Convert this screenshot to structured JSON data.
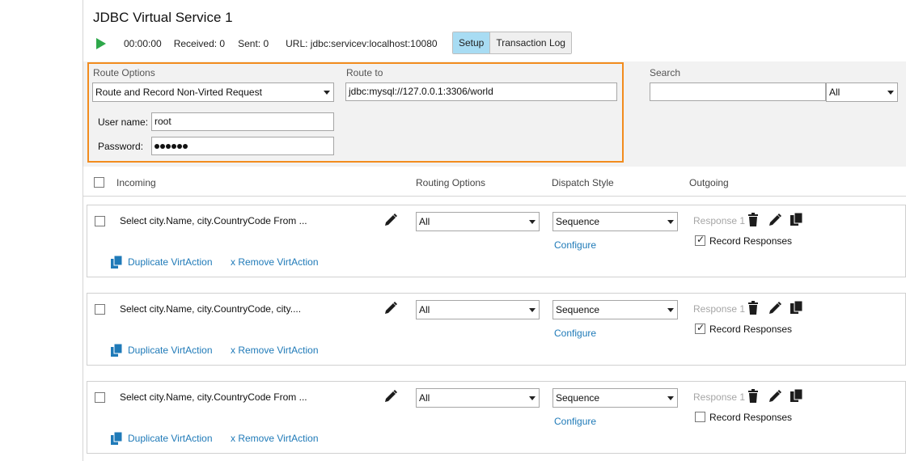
{
  "title": "JDBC Virtual Service 1",
  "toolbar": {
    "time": "00:00:00",
    "received": "Received: 0",
    "sent": "Sent: 0",
    "url": "URL: jdbc:servicev:localhost:10080"
  },
  "tabs": {
    "setup": "Setup",
    "log": "Transaction Log"
  },
  "route": {
    "options_label": "Route Options",
    "options_value": "Route and Record Non-Virted Request",
    "to_label": "Route to",
    "to_value": "jdbc:mysql://127.0.0.1:3306/world",
    "user_label": "User name:",
    "user_value": "root",
    "password_label": "Password:"
  },
  "search": {
    "label": "Search",
    "value": "",
    "filter": "All"
  },
  "columns": {
    "incoming": "Incoming",
    "routing": "Routing Options",
    "dispatch": "Dispatch Style",
    "outgoing": "Outgoing"
  },
  "rows": [
    {
      "query": "Select city.Name, city.CountryCode From ...",
      "routing": "All",
      "dispatch": "Sequence",
      "configure": "Configure",
      "response": "Response 1",
      "record": "Record Responses",
      "recorded": true,
      "duplicate": "Duplicate VirtAction",
      "remove": "x Remove VirtAction"
    },
    {
      "query": "Select city.Name, city.CountryCode, city....",
      "routing": "All",
      "dispatch": "Sequence",
      "configure": "Configure",
      "response": "Response 1",
      "record": "Record Responses",
      "recorded": true,
      "duplicate": "Duplicate VirtAction",
      "remove": "x Remove VirtAction"
    },
    {
      "query": "Select city.Name, city.CountryCode From ...",
      "routing": "All",
      "dispatch": "Sequence",
      "configure": "Configure",
      "response": "Response 1",
      "record": "Record Responses",
      "recorded": false,
      "duplicate": "Duplicate VirtAction",
      "remove": "x Remove VirtAction"
    }
  ],
  "colors": {
    "accent_orange": "#f28c1e",
    "link_blue": "#1f7ab8",
    "play_green": "#2ea84a",
    "active_tab": "#a8dcf3"
  }
}
